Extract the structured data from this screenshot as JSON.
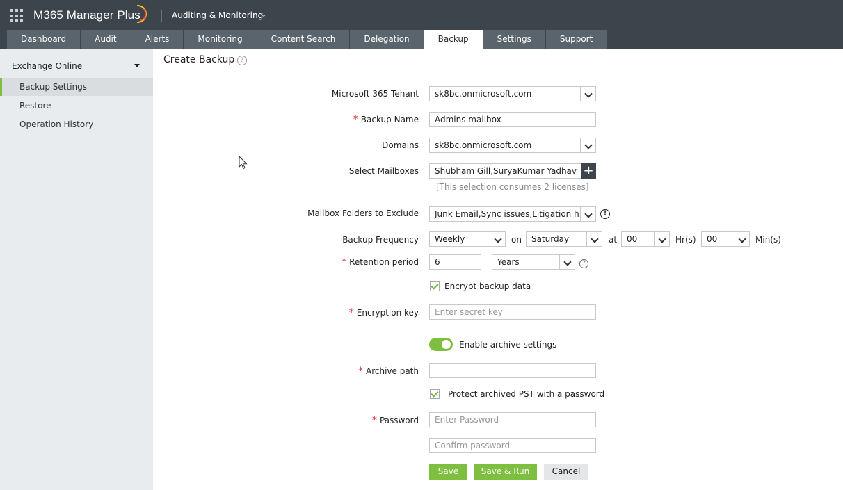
{
  "header": {
    "brand": "M365 Manager Plus",
    "module": "Auditing & Monitoring",
    "accent_color": "#7fbf3f",
    "tabs": [
      "Dashboard",
      "Audit",
      "Alerts",
      "Monitoring",
      "Content Search",
      "Delegation",
      "Backup",
      "Settings",
      "Support"
    ],
    "active_tab": "Backup"
  },
  "sidebar": {
    "section": "Exchange Online",
    "items": [
      {
        "label": "Backup Settings",
        "active": true
      },
      {
        "label": "Restore",
        "active": false
      },
      {
        "label": "Operation History",
        "active": false
      }
    ]
  },
  "page": {
    "title": "Create Backup",
    "help_icon": "?"
  },
  "form": {
    "tenant": {
      "label": "Microsoft 365 Tenant",
      "value": "sk8bc.onmicrosoft.com"
    },
    "backup_name": {
      "label": "Backup Name",
      "required": "*",
      "value": "Admins mailbox"
    },
    "domains": {
      "label": "Domains",
      "value": "sk8bc.onmicrosoft.com"
    },
    "mailboxes": {
      "label": "Select Mailboxes",
      "value": "Shubham Gill,SuryaKumar Yadhav",
      "add_icon": "+",
      "hint": "[This selection consumes 2 licenses]"
    },
    "exclude_folders": {
      "label": "Mailbox Folders to Exclude",
      "value": "Junk Email,Sync issues,Litigation h...",
      "info_icon": "!"
    },
    "frequency": {
      "label": "Backup Frequency",
      "value": "Weekly",
      "on_label": "on",
      "day": "Saturday",
      "at_label": "at",
      "hour": "00",
      "hour_label": "Hr(s)",
      "minute": "00",
      "minute_label": "Min(s)"
    },
    "retention": {
      "label": "Retention period",
      "required": "*",
      "value": "6",
      "unit": "Years",
      "help_icon": "?"
    },
    "encrypt": {
      "label": "Encrypt backup data",
      "checked": true
    },
    "encryption_key": {
      "label": "Encryption key",
      "required": "*",
      "placeholder": "Enter secret key"
    },
    "archive": {
      "label": "Enable archive settings",
      "enabled": true
    },
    "archive_path": {
      "label": "Archive path",
      "required": "*",
      "value": ""
    },
    "protect_pst": {
      "label": "Protect archived PST with a password",
      "checked": true
    },
    "password": {
      "label": "Password",
      "required": "*",
      "placeholder": "Enter Password"
    },
    "confirm_password": {
      "placeholder": "Confirm password"
    },
    "buttons": {
      "save": "Save",
      "save_run": "Save & Run",
      "cancel": "Cancel"
    }
  }
}
